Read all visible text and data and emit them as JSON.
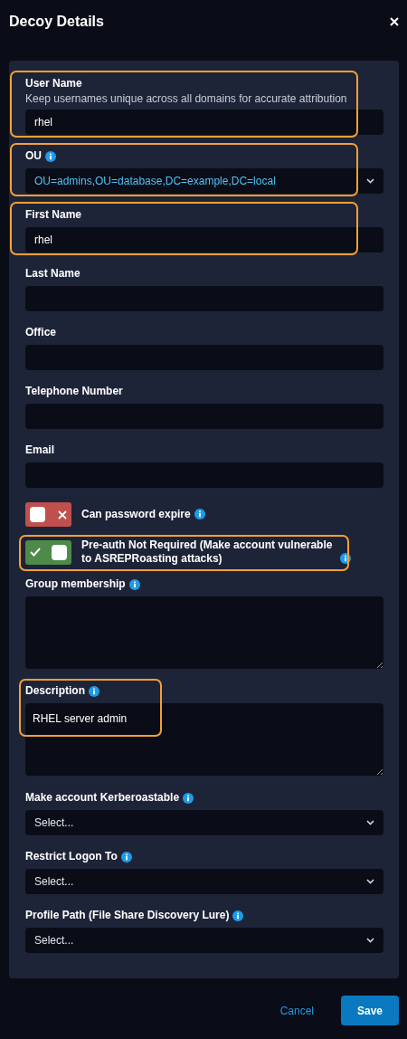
{
  "dialog": {
    "title": "Decoy Details"
  },
  "fields": [
    {
      "kind": "text",
      "label": "User Name",
      "info": false,
      "hint": "Keep usernames unique across all domains for accurate attribution",
      "value": "rhel",
      "highlighted": true
    },
    {
      "kind": "select",
      "label": "OU",
      "info": true,
      "value": "OU=admins,OU=database,DC=example,DC=local",
      "highlighted": true
    },
    {
      "kind": "text",
      "label": "First Name",
      "info": false,
      "value": "rhel",
      "highlighted": true
    },
    {
      "kind": "text",
      "label": "Last Name",
      "info": false,
      "highlighted": false
    },
    {
      "kind": "text",
      "label": "Office",
      "info": false,
      "highlighted": false
    },
    {
      "kind": "text",
      "label": "Telephone Number",
      "info": false,
      "highlighted": false
    },
    {
      "kind": "text",
      "label": "Email",
      "info": false,
      "highlighted": false
    },
    {
      "kind": "toggle",
      "label": "Can password expire",
      "info": true,
      "on": false,
      "highlighted": false
    },
    {
      "kind": "toggle",
      "label": "Pre-auth Not Required (Make account vulnerable to ASREPRoasting attacks)",
      "info": true,
      "on": true,
      "highlighted": true
    },
    {
      "kind": "textarea",
      "label": "Group membership",
      "info": true,
      "highlighted": false
    },
    {
      "kind": "textarea",
      "label": "Description",
      "info": true,
      "value": "RHEL server admin",
      "highlighted": true
    },
    {
      "kind": "select",
      "label": "Make account Kerberoastable",
      "info": true,
      "placeholder": "Select...",
      "highlighted": false
    },
    {
      "kind": "select",
      "label": "Restrict Logon To",
      "info": true,
      "placeholder": "Select...",
      "highlighted": false
    },
    {
      "kind": "select",
      "label": "Profile Path (File Share Discovery Lure)",
      "info": true,
      "placeholder": "Select...",
      "highlighted": false
    }
  ],
  "buttons": {
    "cancel": "Cancel",
    "save": "Save"
  }
}
